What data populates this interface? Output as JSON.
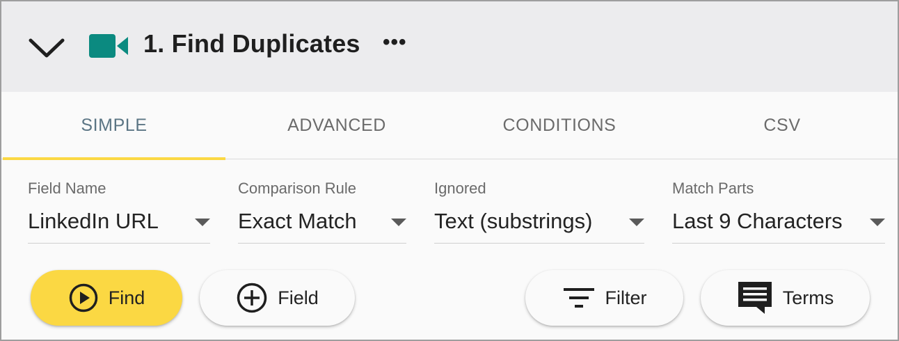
{
  "header": {
    "title": "1. Find Duplicates",
    "more_label": "•••",
    "icons": {
      "collapse": "chevron-down-icon",
      "app": "video-camera-icon"
    },
    "accent_color": "#0b8a80"
  },
  "tabs": [
    {
      "label": "SIMPLE",
      "active": true
    },
    {
      "label": "ADVANCED",
      "active": false
    },
    {
      "label": "CONDITIONS",
      "active": false
    },
    {
      "label": "CSV",
      "active": false
    }
  ],
  "fields": [
    {
      "label": "Field Name",
      "value": "LinkedIn URL"
    },
    {
      "label": "Comparison Rule",
      "value": "Exact Match"
    },
    {
      "label": "Ignored",
      "value": "Text (substrings)"
    },
    {
      "label": "Match Parts",
      "value": "Last 9 Characters"
    }
  ],
  "buttons": {
    "find": {
      "label": "Find",
      "icon": "play-circle-icon"
    },
    "field": {
      "label": "Field",
      "icon": "add-circle-icon"
    },
    "filter": {
      "label": "Filter",
      "icon": "filter-icon"
    },
    "terms": {
      "label": "Terms",
      "icon": "comment-icon"
    }
  },
  "colors": {
    "primary_button": "#fbd843",
    "active_tab_underline": "#fbd843",
    "active_tab_text": "#5b7584"
  }
}
